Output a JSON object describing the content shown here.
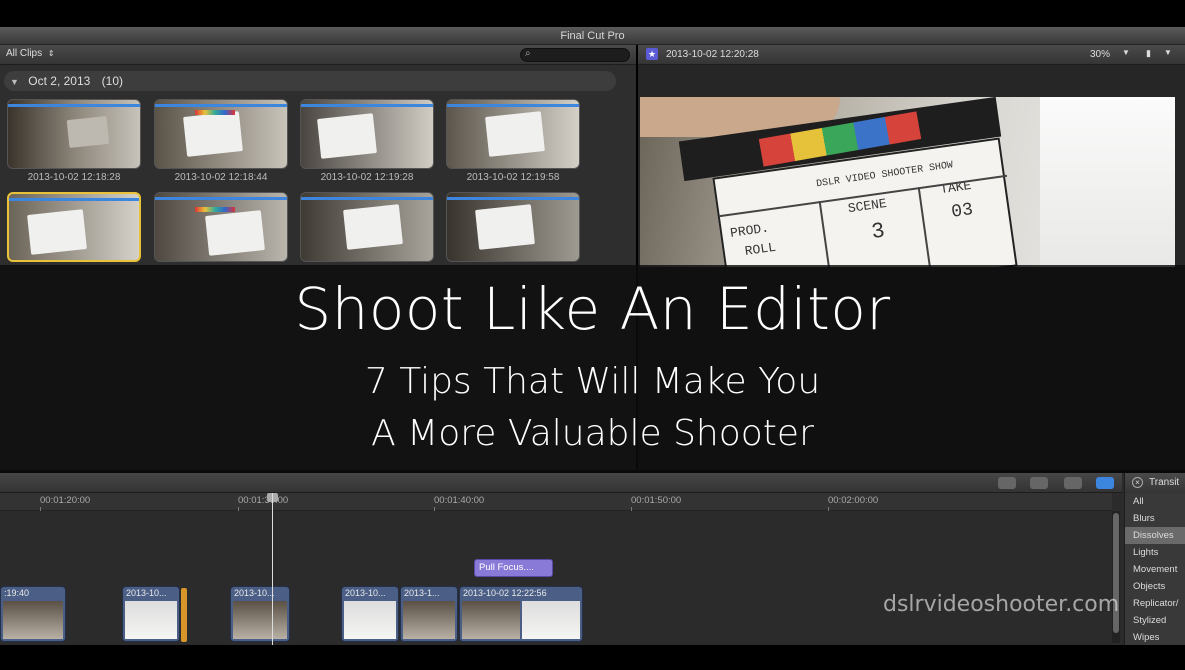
{
  "window": {
    "title": "Final Cut Pro"
  },
  "browser": {
    "clip_filter": "All Clips",
    "clip_filter_caret": "⇕",
    "event_header": {
      "date": "Oct 2, 2013",
      "count": "(10)"
    },
    "clips": [
      {
        "label": "2013-10-02 12:18:28"
      },
      {
        "label": "2013-10-02 12:18:44"
      },
      {
        "label": "2013-10-02 12:19:28"
      },
      {
        "label": "2013-10-02 12:19:58"
      }
    ]
  },
  "viewer": {
    "clip_name": "2013-10-02 12:20:28",
    "zoom": "30%",
    "slate": {
      "prod": "PROD.",
      "roll": "ROLL",
      "scene": "SCENE",
      "take": "TAKE",
      "scene_value": "3",
      "take_value": "03",
      "show": "DSLR VIDEO SHOOTER SHOW"
    }
  },
  "overlay": {
    "headline": "Shoot Like An Editor",
    "line1": "7 Tips That Will Make You",
    "line2": "A More Valuable Shooter"
  },
  "timeline": {
    "ticks": [
      "00:01:20:00",
      "00:01:30:00",
      "00:01:40:00",
      "00:01:50:00",
      "00:02:00:00"
    ],
    "title_clip": "Pull Focus....",
    "clips": [
      {
        "label": ":19:40"
      },
      {
        "label": "2013-10..."
      },
      {
        "label": "2013-10..."
      },
      {
        "label": "2013-10..."
      },
      {
        "label": "2013-1..."
      },
      {
        "label": "2013-10-02 12:22:56"
      }
    ]
  },
  "effects": {
    "header": "Transit",
    "items": [
      "All",
      "Blurs",
      "Dissolves",
      "Lights",
      "Movement",
      "Objects",
      "Replicator/",
      "Stylized",
      "Wipes"
    ],
    "selected": "Dissolves"
  },
  "watermark": "dslrvideoshooter.com",
  "colors": {
    "selection_yellow": "#e8c33a",
    "clip_blue": "#4b5f86",
    "title_purple": "#8a7ad8",
    "analysis_blue": "#3d86e0"
  },
  "icons": [
    "search-icon",
    "star-icon",
    "disclosure-triangle-icon",
    "close-icon"
  ]
}
